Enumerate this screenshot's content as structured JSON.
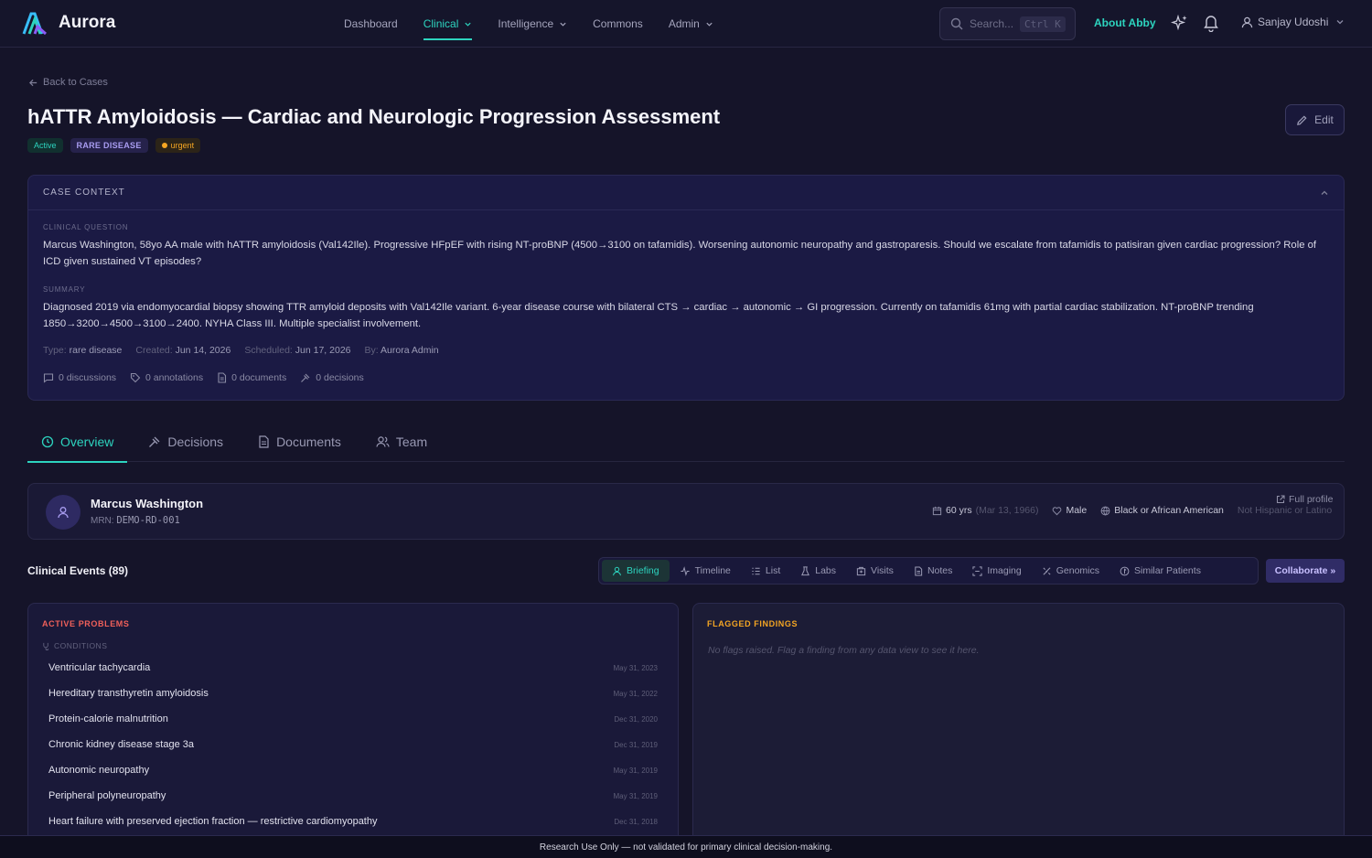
{
  "app": {
    "name": "Aurora"
  },
  "nav": {
    "items": [
      {
        "label": "Dashboard",
        "active": false,
        "dropdown": false
      },
      {
        "label": "Clinical",
        "active": true,
        "dropdown": true
      },
      {
        "label": "Intelligence",
        "active": false,
        "dropdown": true
      },
      {
        "label": "Commons",
        "active": false,
        "dropdown": false
      },
      {
        "label": "Admin",
        "active": false,
        "dropdown": true
      }
    ],
    "search_placeholder": "Search...",
    "search_shortcut": "Ctrl K",
    "about": "About Abby",
    "user_name": "Sanjay Udoshi"
  },
  "page": {
    "back_label": "Back to Cases",
    "title": "hATTR Amyloidosis — Cardiac and Neurologic Progression Assessment",
    "badges": {
      "status": "Active",
      "category": "RARE DISEASE",
      "priority": "urgent"
    },
    "edit_label": "Edit"
  },
  "context": {
    "header": "CASE CONTEXT",
    "question_label": "CLINICAL QUESTION",
    "question": "Marcus Washington, 58yo AA male with hATTR amyloidosis (Val142Ile). Progressive HFpEF with rising NT-proBNP (4500→3100 on tafamidis). Worsening autonomic neuropathy and gastroparesis. Should we escalate from tafamidis to patisiran given cardiac progression? Role of ICD given sustained VT episodes?",
    "summary_label": "SUMMARY",
    "summary": "Diagnosed 2019 via endomyocardial biopsy showing TTR amyloid deposits with Val142Ile variant. 6-year disease course with bilateral CTS → cardiac → autonomic → GI progression. Currently on tafamidis 61mg with partial cardiac stabilization. NT-proBNP trending 1850→3200→4500→3100→2400. NYHA Class III. Multiple specialist involvement.",
    "meta": {
      "type_label": "Type:",
      "type": "rare disease",
      "created_label": "Created:",
      "created": "Jun 14, 2026",
      "scheduled_label": "Scheduled:",
      "scheduled": "Jun 17, 2026",
      "by_label": "By:",
      "by": "Aurora Admin"
    },
    "counts": {
      "discussions": "0 discussions",
      "annotations": "0 annotations",
      "documents": "0 documents",
      "decisions": "0 decisions"
    }
  },
  "tabs": [
    {
      "label": "Overview",
      "active": true,
      "icon": "clock-icon"
    },
    {
      "label": "Decisions",
      "active": false,
      "icon": "gavel-icon"
    },
    {
      "label": "Documents",
      "active": false,
      "icon": "document-icon"
    },
    {
      "label": "Team",
      "active": false,
      "icon": "users-icon"
    }
  ],
  "patient": {
    "name": "Marcus Washington",
    "mrn_label": "MRN:",
    "mrn": "DEMO-RD-001",
    "age": "60 yrs",
    "dob": "(Mar 13, 1966)",
    "sex": "Male",
    "race": "Black or African American",
    "ethnicity": "Not Hispanic or Latino",
    "full_profile": "Full profile"
  },
  "events": {
    "title": "Clinical Events (89)",
    "views": [
      {
        "label": "Briefing",
        "active": true,
        "icon": "person-icon"
      },
      {
        "label": "Timeline",
        "active": false,
        "icon": "pulse-icon"
      },
      {
        "label": "List",
        "active": false,
        "icon": "list-icon"
      },
      {
        "label": "Labs",
        "active": false,
        "icon": "flask-icon"
      },
      {
        "label": "Visits",
        "active": false,
        "icon": "building-icon"
      },
      {
        "label": "Notes",
        "active": false,
        "icon": "note-icon"
      },
      {
        "label": "Imaging",
        "active": false,
        "icon": "scan-icon"
      },
      {
        "label": "Genomics",
        "active": false,
        "icon": "dna-icon"
      },
      {
        "label": "Similar Patients",
        "active": false,
        "icon": "compass-icon"
      }
    ],
    "collaborate": "Collaborate »"
  },
  "problems": {
    "title": "ACTIVE PROBLEMS",
    "section": "CONDITIONS",
    "items": [
      {
        "name": "Ventricular tachycardia",
        "date": "May 31, 2023"
      },
      {
        "name": "Hereditary transthyretin amyloidosis",
        "date": "May 31, 2022"
      },
      {
        "name": "Protein-calorie malnutrition",
        "date": "Dec 31, 2020"
      },
      {
        "name": "Chronic kidney disease stage 3a",
        "date": "Dec 31, 2019"
      },
      {
        "name": "Autonomic neuropathy",
        "date": "May 31, 2019"
      },
      {
        "name": "Peripheral polyneuropathy",
        "date": "May 31, 2019"
      },
      {
        "name": "Heart failure with preserved ejection fraction — restrictive cardiomyopathy",
        "date": "Dec 31, 2018"
      }
    ]
  },
  "flagged": {
    "title": "FLAGGED FINDINGS",
    "empty": "No flags raised. Flag a finding from any data view to see it here."
  },
  "footer": "Research Use Only — not validated for primary clinical decision-making.",
  "colors": {
    "accent": "#2dd4bf",
    "danger": "#f0605a",
    "warning": "#f5a623",
    "purple": "#a89cf0"
  }
}
